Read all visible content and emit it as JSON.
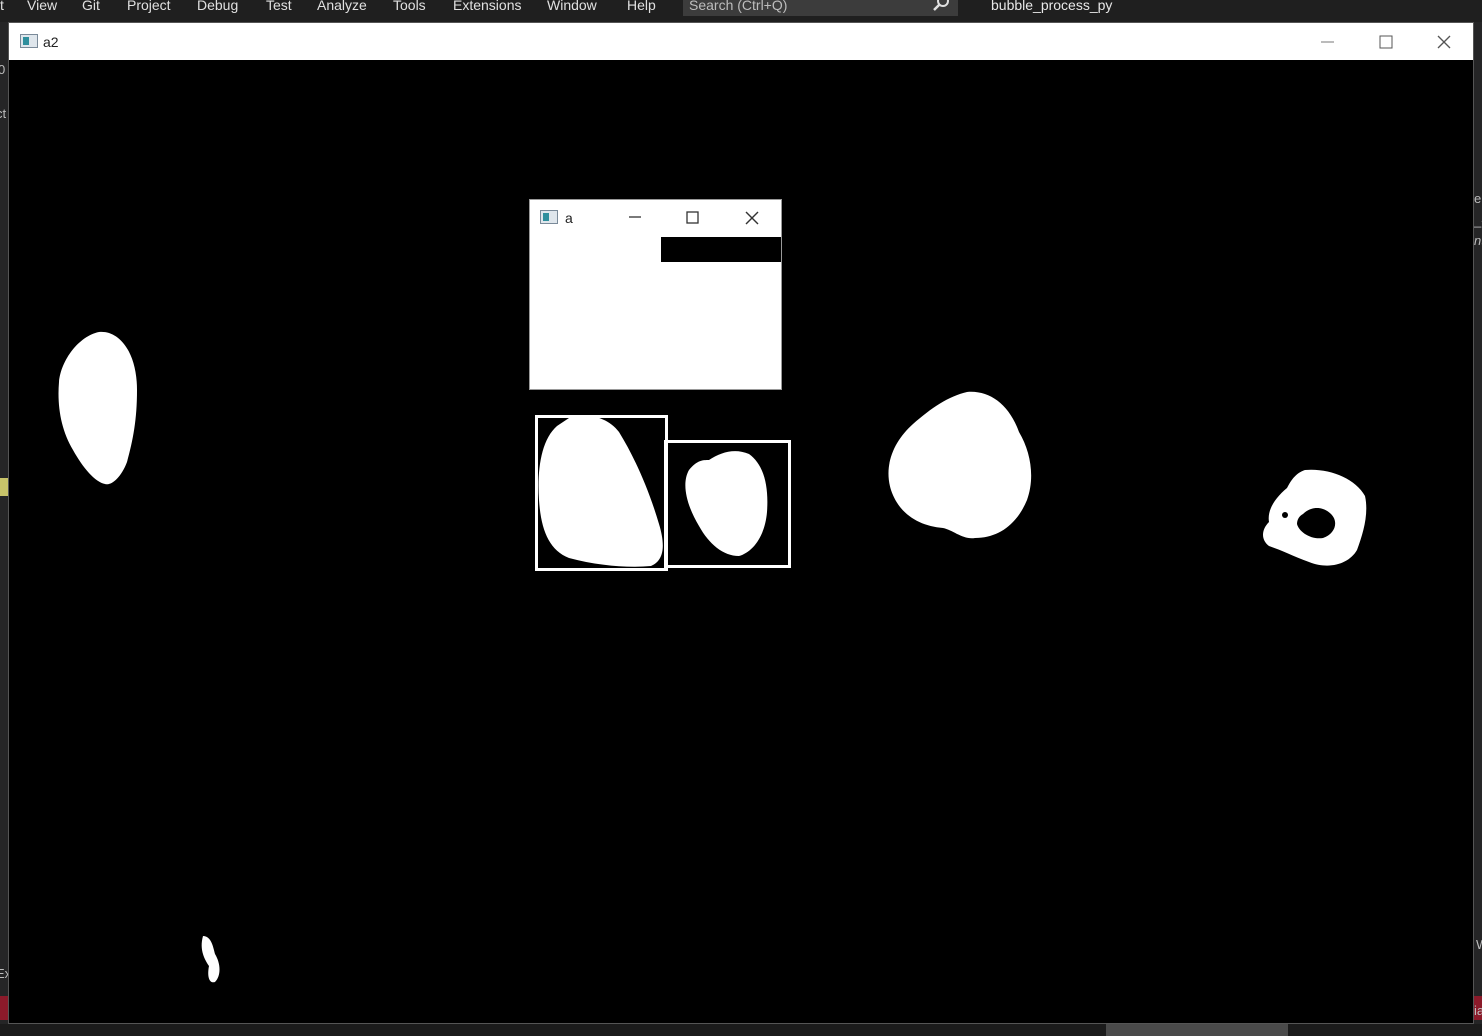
{
  "ide": {
    "menu": [
      "t",
      "View",
      "Git",
      "Project",
      "Debug",
      "Test",
      "Analyze",
      "Tools",
      "Extensions",
      "Window",
      "Help"
    ],
    "search_placeholder": "Search (Ctrl+Q)",
    "solution_title": "bubble_process_py",
    "left_fragments": [
      "0",
      "ct",
      "Ex"
    ],
    "right_fragments": [
      "e",
      "_-",
      "nt",
      "W",
      "ia"
    ]
  },
  "window_a2": {
    "title": "a2",
    "controls": {
      "minimize": "minimize-icon",
      "maximize": "maximize-icon",
      "close": "close-icon"
    },
    "background_color": "#000000",
    "foreground_color": "#ffffff"
  },
  "window_a": {
    "title": "a",
    "controls": {
      "minimize": "minimize-icon",
      "maximize": "maximize-icon",
      "close": "close-icon"
    }
  }
}
